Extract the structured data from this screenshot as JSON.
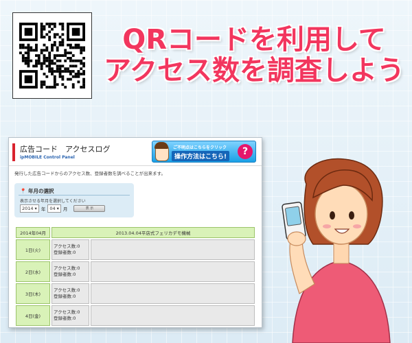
{
  "headline": {
    "line1": "QRコードを利用して",
    "line2": "アクセス数を調査しよう"
  },
  "panel": {
    "title": "広告コード　アクセスログ",
    "subtitle": "ipMOBILE Control Panel",
    "help_small": "ご不明点はこちらをクリック",
    "help_big": "操作方法はこちら!",
    "help_icon": "?",
    "description": "発行した広告コードからのアクセス数、登録者数を調べることが出来ます。",
    "select": {
      "title": "年月の選択",
      "hint": "表示させる年月を選択してください",
      "year": "2014",
      "year_suffix": "年",
      "month": "04",
      "month_suffix": "月",
      "button_label": "表 示"
    },
    "table": {
      "header_date": "2014年04月",
      "header_shop": "2013.04.04平店式フェリカデモ機械",
      "rows": [
        {
          "day": "1日(火)",
          "access": "アクセス数:0",
          "registered": "登録者数:0"
        },
        {
          "day": "2日(水)",
          "access": "アクセス数:0",
          "registered": "登録者数:0"
        },
        {
          "day": "3日(木)",
          "access": "アクセス数:0",
          "registered": "登録者数:0"
        },
        {
          "day": "4日(金)",
          "access": "アクセス数:0",
          "registered": "登録者数:0"
        }
      ]
    }
  },
  "colors": {
    "headline": "#f2365e",
    "accent_red": "#d9232e",
    "table_green": "#d9f2b8"
  },
  "icons": {
    "qr": "qr-code-icon",
    "pin": "pin-icon",
    "woman": "woman-with-phone-illustration"
  }
}
